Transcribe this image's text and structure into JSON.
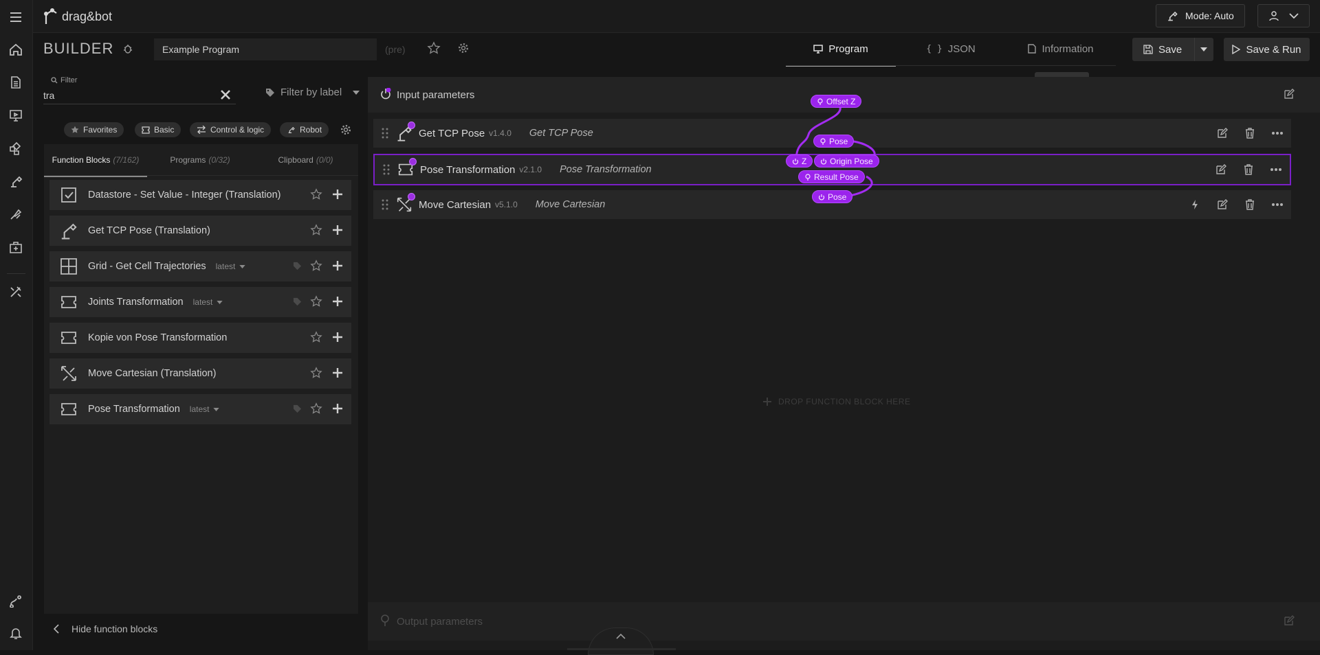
{
  "app": {
    "logo_text": "drag&bot",
    "mode_label": "Mode: Auto"
  },
  "builder": {
    "title": "BUILDER",
    "program_name": "Example Program",
    "pre_label": "(pre)",
    "tabs": [
      {
        "label": "Program"
      },
      {
        "label": "JSON"
      },
      {
        "label": "Information"
      }
    ],
    "tooltip": "Information",
    "save_label": "Save",
    "save_run_label": "Save & Run"
  },
  "filter": {
    "label": "Filter",
    "value": "tra",
    "label_filter": "Filter by label"
  },
  "chips": [
    {
      "label": "Favorites",
      "icon": "star-icon"
    },
    {
      "label": "Basic",
      "icon": "puzzle-icon"
    },
    {
      "label": "Control & logic",
      "icon": "arrows-icon"
    },
    {
      "label": "Robot",
      "icon": "robot-arm-icon"
    }
  ],
  "side_tabs": [
    {
      "label": "Function Blocks",
      "count": "(7/162)"
    },
    {
      "label": "Programs",
      "count": "(0/32)"
    },
    {
      "label": "Clipboard",
      "count": "(0/0)"
    }
  ],
  "function_blocks": [
    {
      "name": "Datastore - Set Value - Integer (Translation)",
      "version": "",
      "icon": "checkbox-icon"
    },
    {
      "name": "Get TCP Pose (Translation)",
      "version": "",
      "icon": "robot-arm-icon"
    },
    {
      "name": "Grid - Get Cell Trajectories",
      "version": "latest",
      "icon": "grid-icon"
    },
    {
      "name": "Joints Transformation",
      "version": "latest",
      "icon": "puzzle-icon"
    },
    {
      "name": "Kopie von Pose Transformation",
      "version": "",
      "icon": "puzzle-icon"
    },
    {
      "name": "Move Cartesian (Translation)",
      "version": "",
      "icon": "move-cartesian-icon"
    },
    {
      "name": "Pose Transformation",
      "version": "latest",
      "icon": "puzzle-icon"
    }
  ],
  "hide_function_blocks": "Hide function blocks",
  "canvas": {
    "input_params": "Input parameters",
    "output_params": "Output parameters",
    "dropzone": "DROP FUNCTION BLOCK HERE",
    "program_rows": [
      {
        "name": "Get TCP Pose",
        "version": "v1.4.0",
        "alias": "Get TCP Pose",
        "icon": "robot-arm-icon",
        "selected": false
      },
      {
        "name": "Pose Transformation",
        "version": "v2.1.0",
        "alias": "Pose Transformation",
        "icon": "puzzle-icon",
        "selected": true
      },
      {
        "name": "Move Cartesian",
        "version": "v5.1.0",
        "alias": "Move Cartesian",
        "icon": "move-cartesian-icon",
        "selected": false
      }
    ],
    "pills": {
      "offset_z": "Offset Z",
      "pose_out": "Pose",
      "z": "Z",
      "origin_pose": "Origin Pose",
      "result_pose": "Result Pose",
      "pose_in": "Pose"
    }
  },
  "colors": {
    "accent_purple": "#9b24ec",
    "background": "#161616"
  }
}
